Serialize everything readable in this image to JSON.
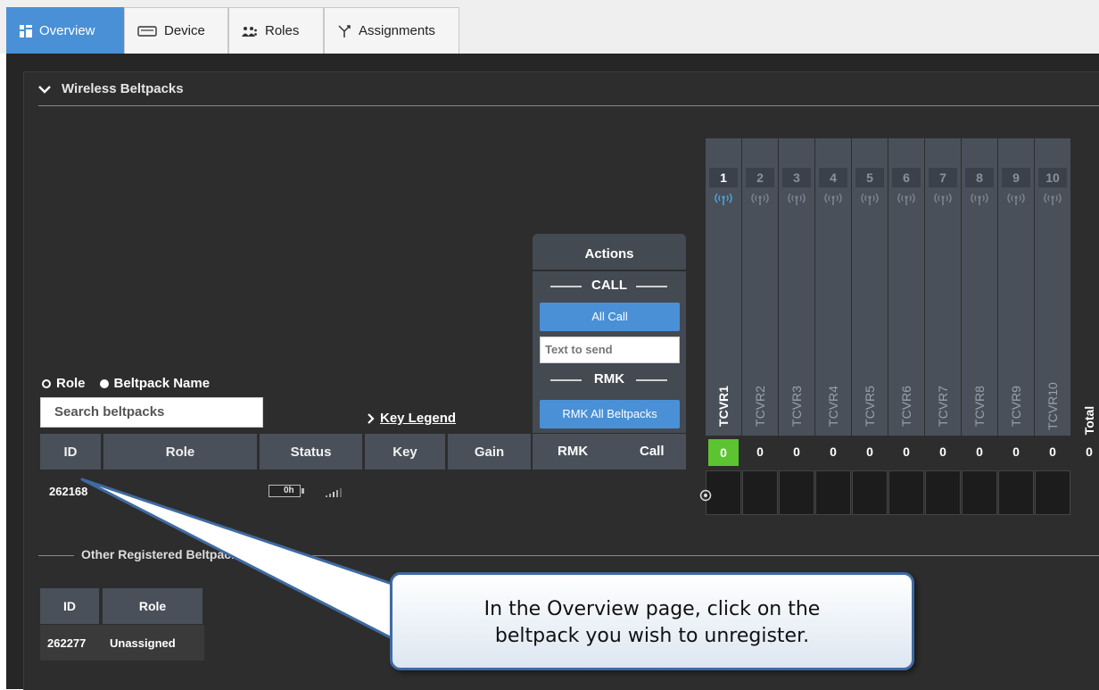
{
  "tabs": [
    {
      "label": "Overview",
      "icon": "grid-icon",
      "active": true
    },
    {
      "label": "Device",
      "icon": "device-icon",
      "active": false
    },
    {
      "label": "Roles",
      "icon": "people-icon",
      "active": false
    },
    {
      "label": "Assignments",
      "icon": "fork-icon",
      "active": false
    }
  ],
  "section": {
    "title": "Wireless Beltpacks"
  },
  "search": {
    "options": [
      "Role",
      "Beltpack Name"
    ],
    "selected": "Role",
    "placeholder": "Search beltpacks",
    "key_legend": "Key Legend"
  },
  "table": {
    "headers": [
      "ID",
      "Role",
      "Status",
      "Key",
      "Gain",
      "RMK",
      "Call"
    ],
    "rows": [
      {
        "id": "262168",
        "role": "",
        "battery": "0h"
      }
    ]
  },
  "actions": {
    "title": "Actions",
    "call_label": "CALL",
    "all_call": "All Call",
    "text_placeholder": "Text to send",
    "rmk_label": "RMK",
    "rmk_all": "RMK All Beltpacks"
  },
  "transceivers": [
    {
      "num": "1",
      "label": "TCVR1",
      "count": "0"
    },
    {
      "num": "2",
      "label": "TCVR2",
      "count": "0"
    },
    {
      "num": "3",
      "label": "TCVR3",
      "count": "0"
    },
    {
      "num": "4",
      "label": "TCVR4",
      "count": "0"
    },
    {
      "num": "5",
      "label": "TCVR5",
      "count": "0"
    },
    {
      "num": "6",
      "label": "TCVR6",
      "count": "0"
    },
    {
      "num": "7",
      "label": "TCVR7",
      "count": "0"
    },
    {
      "num": "8",
      "label": "TCVR8",
      "count": "0"
    },
    {
      "num": "9",
      "label": "TCVR9",
      "count": "0"
    },
    {
      "num": "10",
      "label": "TCVR10",
      "count": "0"
    }
  ],
  "total": {
    "label": "Total",
    "count": "0"
  },
  "other": {
    "title": "Other Registered Beltpacks",
    "headers": [
      "ID",
      "Role"
    ],
    "rows": [
      {
        "id": "262277",
        "role": "Unassigned"
      }
    ]
  },
  "callout": {
    "line1": "In the Overview page, click on the",
    "line2": "beltpack you wish to unregister."
  },
  "colors": {
    "accent": "#4a90d6",
    "active_tcvr": "#5cc431",
    "panel": "#2d2d2d",
    "header": "#49505a"
  }
}
